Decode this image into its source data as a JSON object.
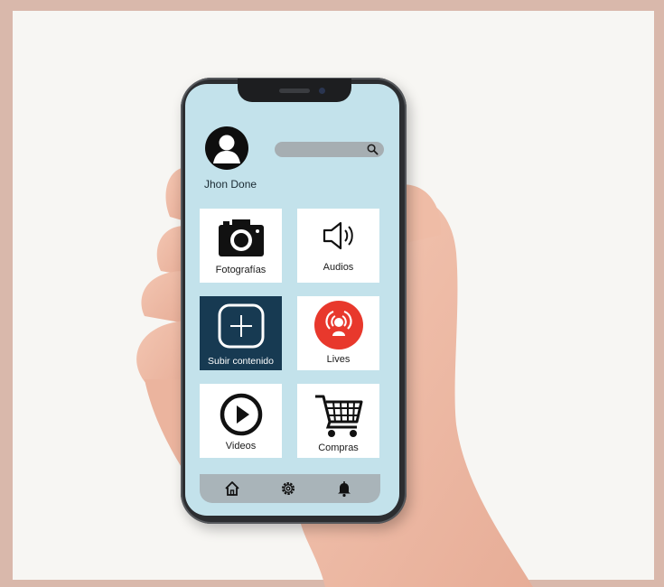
{
  "profile": {
    "username": "Jhon Done"
  },
  "search": {
    "placeholder": ""
  },
  "tiles": [
    {
      "label": "Fotografías",
      "icon": "camera-icon"
    },
    {
      "label": "Audios",
      "icon": "speaker-icon"
    },
    {
      "label": "Subir contenido",
      "icon": "plus-square-icon"
    },
    {
      "label": "Lives",
      "icon": "live-broadcast-icon"
    },
    {
      "label": "Videos",
      "icon": "play-circle-icon"
    },
    {
      "label": "Compras",
      "icon": "shopping-cart-icon"
    }
  ],
  "bottom_nav": [
    {
      "icon": "home-icon"
    },
    {
      "icon": "gear-icon"
    },
    {
      "icon": "bell-icon"
    }
  ],
  "colors": {
    "screen_bg": "#c3e2eb",
    "upload_tile_bg": "#173a52",
    "live_accent": "#e8382c"
  }
}
